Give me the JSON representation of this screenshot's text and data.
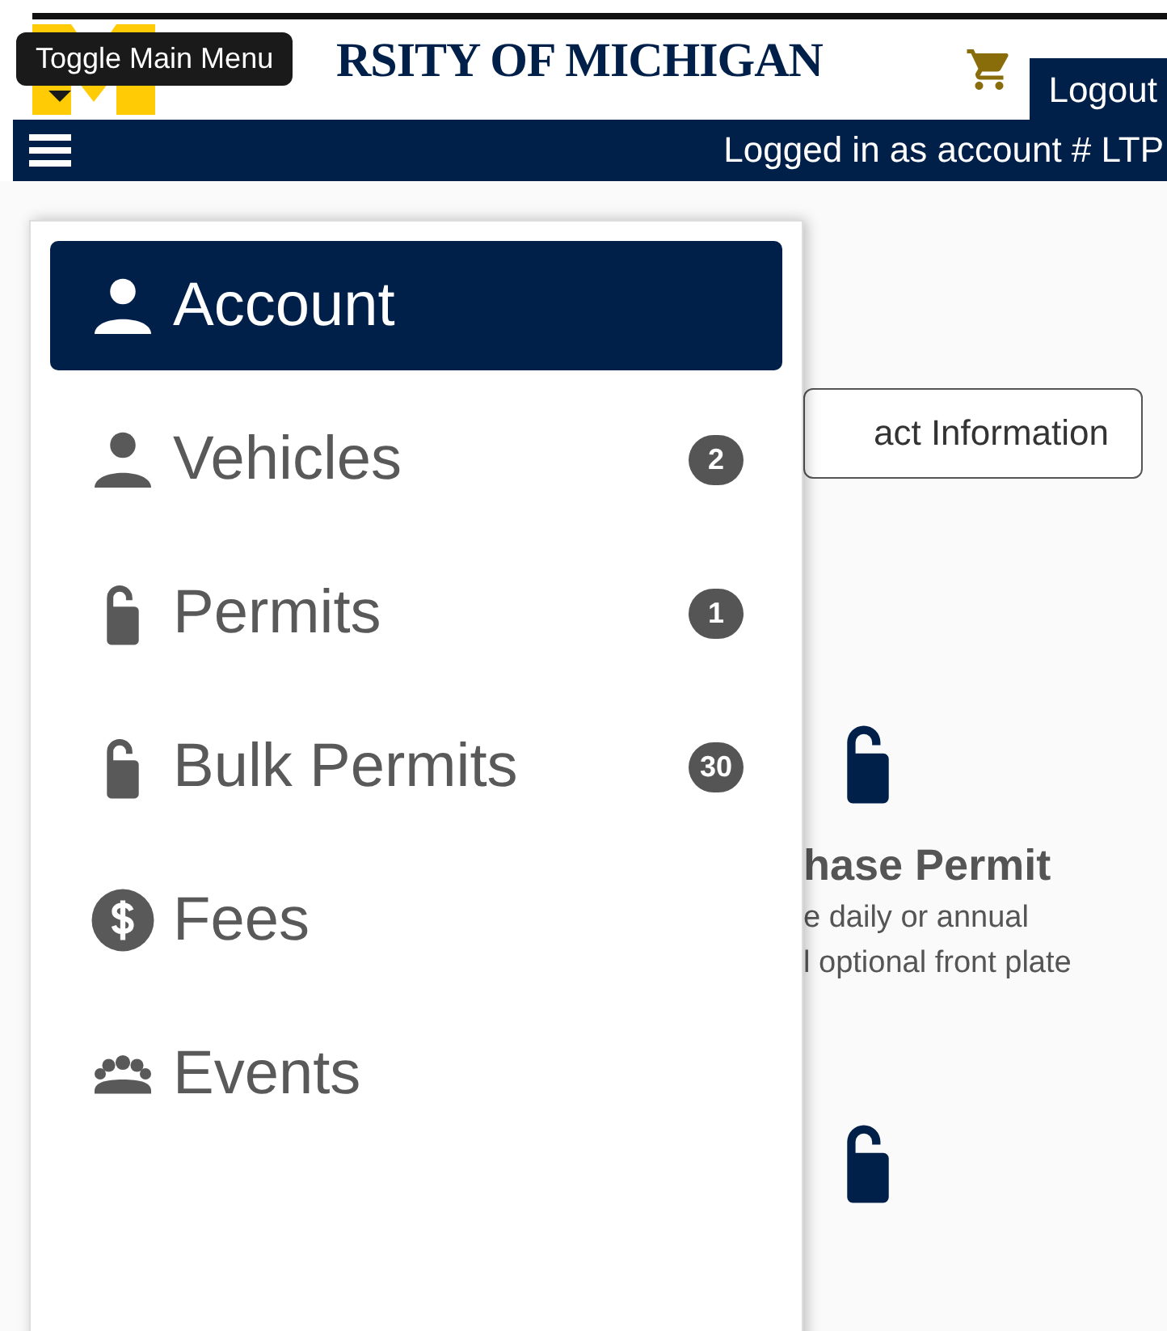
{
  "header": {
    "title": "RSITY OF MICHIGAN",
    "logout": "Logout",
    "tooltip": "Toggle Main Menu",
    "account_line": "Logged in as account # LTP"
  },
  "menu": [
    {
      "label": "Account",
      "kind": "person",
      "selected": true
    },
    {
      "label": "Vehicles",
      "kind": "person",
      "badge": "2",
      "selected": false
    },
    {
      "label": "Permits",
      "kind": "tag",
      "badge": "1",
      "selected": false
    },
    {
      "label": "Bulk Permits",
      "kind": "tag",
      "badge": "30",
      "selected": false
    },
    {
      "label": "Fees",
      "kind": "dollar",
      "selected": false
    },
    {
      "label": "Events",
      "kind": "group",
      "selected": false
    }
  ],
  "content": {
    "contact_button": "act Information",
    "card": {
      "title": "hase Permit",
      "lines": [
        "e daily or annual",
        "l optional front plate"
      ]
    }
  }
}
